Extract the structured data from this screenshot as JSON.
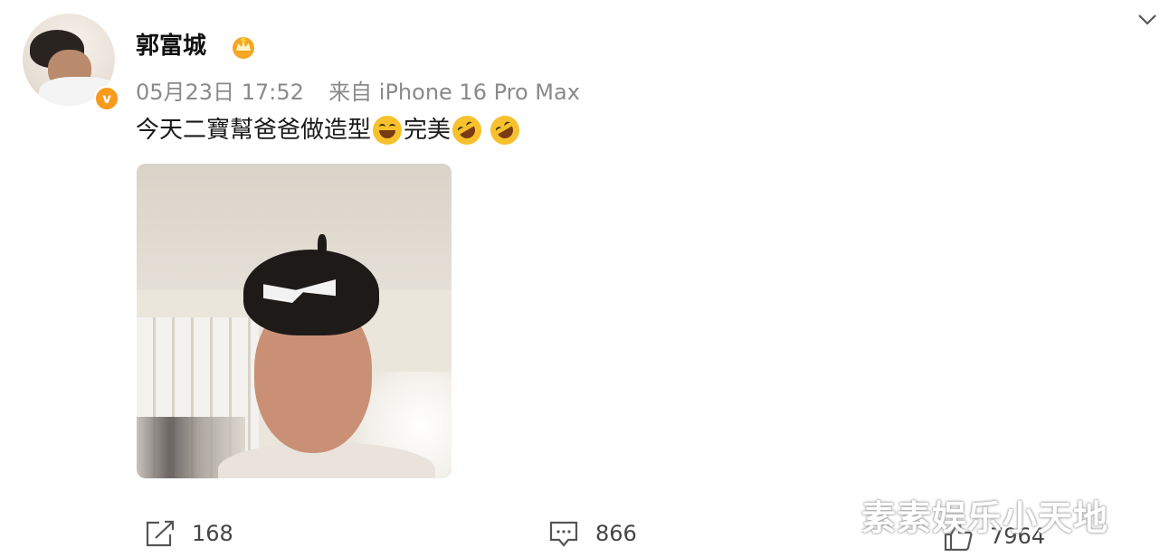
{
  "post": {
    "username": "郭富城",
    "badge_icon": "vip-crown-icon",
    "verified_icon": "verified-v-icon",
    "timestamp": "05月23日 17:52",
    "source": "来自 iPhone 16 Pro Max",
    "text_part1": "今天二寶幫爸爸做造型",
    "text_part2": "完美",
    "emojis": [
      "laughing-face-icon",
      "rofl-face-icon",
      "rofl-face-icon"
    ]
  },
  "actions": {
    "repost_count": "168",
    "comment_count": "866",
    "like_count": "7964"
  },
  "watermark": "素素娱乐小天地",
  "colors": {
    "verified": "#f89a1c",
    "meta_text": "#8a8a8a",
    "accent_crown": "#f5a623"
  }
}
